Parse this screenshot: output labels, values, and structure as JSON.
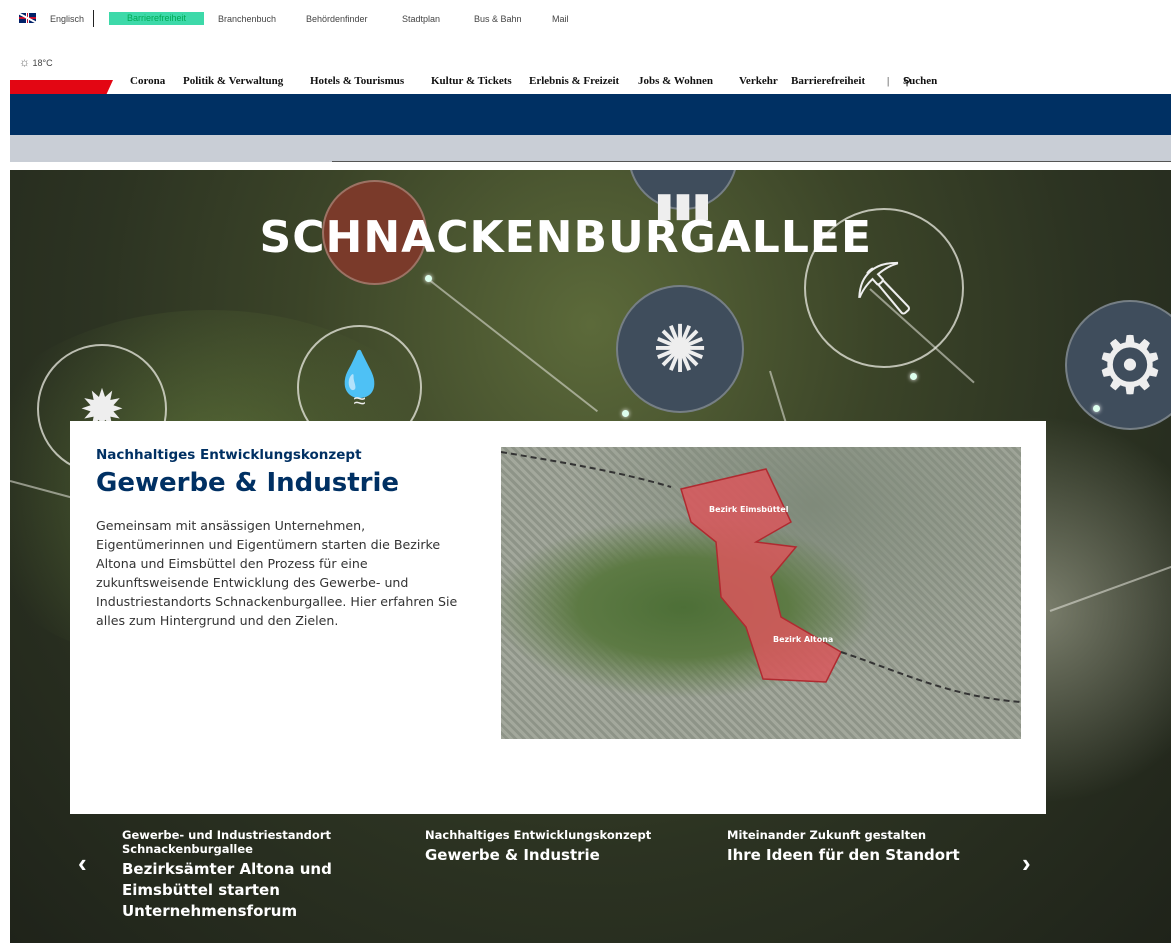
{
  "utility_bar": {
    "language": "Englisch",
    "links": [
      "Barrierefreiheit",
      "Branchenbuch",
      "Behördenfinder",
      "Stadtplan",
      "Bus & Bahn",
      "Mail"
    ]
  },
  "weather": {
    "temperature": "18°C",
    "icon": "sun-icon"
  },
  "main_nav": {
    "items": [
      "Corona",
      "Politik & Verwaltung",
      "Hotels & Tourismus",
      "Kultur & Tickets",
      "Erlebnis & Freizeit",
      "Jobs & Wohnen",
      "Verkehr",
      "Barrierefreiheit"
    ],
    "search_label": "Suchen"
  },
  "colors": {
    "brand_red": "#e30613",
    "brand_blue": "#003063",
    "accent_green": "#3dd9a9"
  },
  "hero": {
    "title": "SCHNACKENBURGALLEE"
  },
  "card": {
    "kicker": "Nachhaltiges Entwicklungskonzept",
    "headline": "Gewerbe & Industrie",
    "body": "Gemeinsam mit ansässigen Unternehmen, Eigentümerinnen und Eigentümern starten die Bezirke Altona und Eimsbüttel den Prozess für eine zukunftsweisende Entwicklung des Gewerbe- und Industriestandorts Schnackenburgallee. Hier erfahren Sie alles zum Hintergrund und den Zielen.",
    "map_labels": [
      "Bezirk Eimsbüttel",
      "Bezirk Altona"
    ]
  },
  "slider": {
    "slides": [
      {
        "kicker": "Gewerbe- und Industriestandort Schnackenburgallee",
        "title": "Bezirksämter Altona und Eimsbüttel starten Unternehmensforum"
      },
      {
        "kicker": "Nachhaltiges Entwicklungskonzept",
        "title": "Gewerbe & Industrie"
      },
      {
        "kicker": "Miteinander Zukunft gestalten",
        "title": "Ihre Ideen für den Standort"
      }
    ],
    "active_index": 1
  }
}
